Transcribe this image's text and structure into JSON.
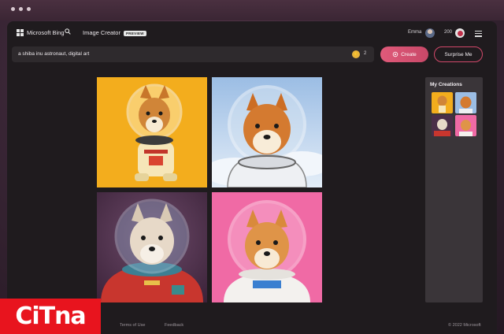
{
  "brand": {
    "name": "Microsoft Bing",
    "product": "Image Creator",
    "badge": "PREVIEW"
  },
  "user": {
    "name": "Emma",
    "coins": "200"
  },
  "prompt": {
    "value": "a shiba inu astronaut, digital art",
    "boosts": "2"
  },
  "buttons": {
    "create": "Create",
    "surprise": "Surprise Me"
  },
  "creations": {
    "title": "My Creations"
  },
  "footer": {
    "terms": "Terms of Use",
    "feedback": "Feedback",
    "copyright": "© 2022 Microsoft"
  },
  "watermark": {
    "text": "CiTna"
  },
  "icons": {
    "windows": "windows-logo-icon",
    "search": "search-icon",
    "menu": "hamburger-menu-icon",
    "reward": "rewards-medal-icon",
    "boost": "boost-coin-icon"
  },
  "colors": {
    "accent": "#d2486a",
    "watermark": "#e8141e",
    "gold": "#e9b43a"
  }
}
